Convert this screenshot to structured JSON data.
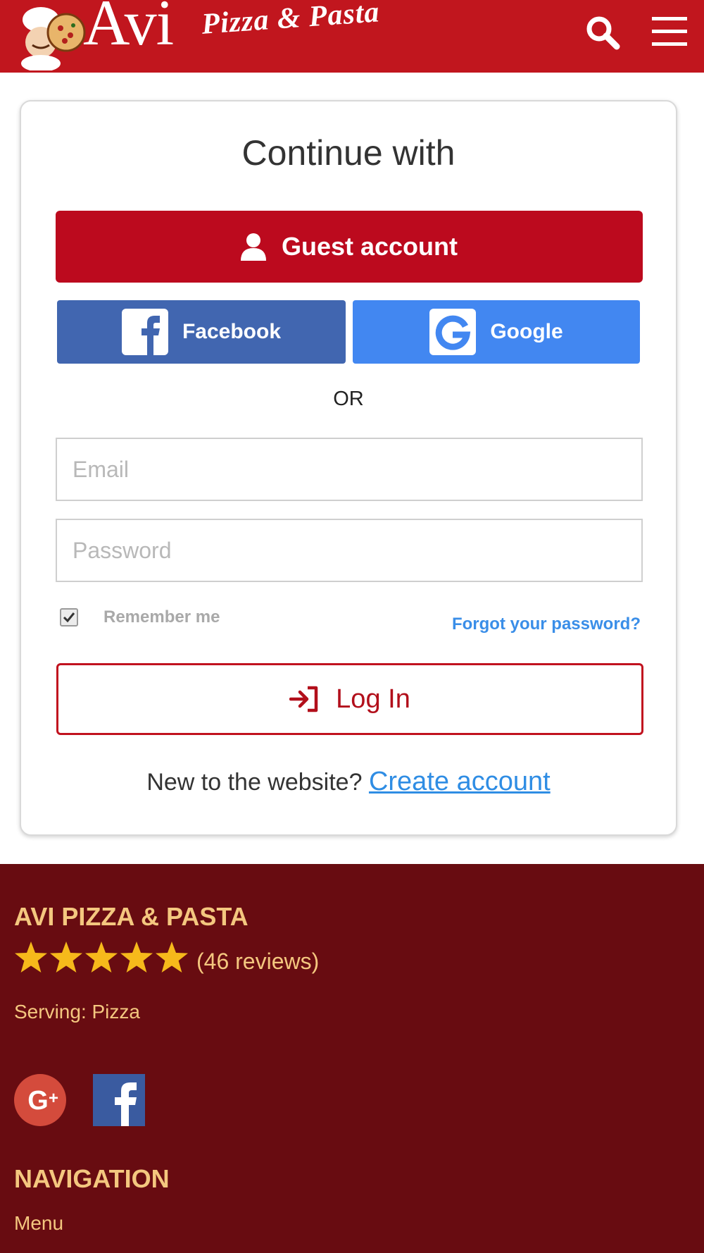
{
  "header": {
    "logo_main": "Avi",
    "logo_sub": "Pizza & Pasta",
    "icons": [
      "chef-logo-icon",
      "search-icon",
      "hamburger-menu-icon"
    ],
    "color": "#c1161e"
  },
  "login": {
    "title": "Continue with",
    "guest_label": "Guest account",
    "facebook_label": "Facebook",
    "google_label": "Google",
    "or_label": "OR",
    "email_placeholder": "Email",
    "password_placeholder": "Password",
    "remember_label": "Remember me",
    "remember_checked": true,
    "forgot_label": "Forgot your password?",
    "login_label": "Log In",
    "new_text": "New to the website?",
    "create_label": "Create account",
    "colors": {
      "guest": "#bc0a1e",
      "facebook": "#4166b0",
      "google": "#4287f1",
      "link": "#2f8de4"
    }
  },
  "footer": {
    "brand": "AVI PIZZA & PASTA",
    "rating": 5,
    "reviews": "(46 reviews)",
    "serving": "Serving: Pizza",
    "social_icons": [
      "google-plus-icon",
      "facebook-icon"
    ],
    "nav_title": "NAVIGATION",
    "nav_items": [
      "Menu"
    ],
    "colors": {
      "background": "#680c11",
      "text": "#f4c77f",
      "star": "#f6b91b"
    }
  }
}
